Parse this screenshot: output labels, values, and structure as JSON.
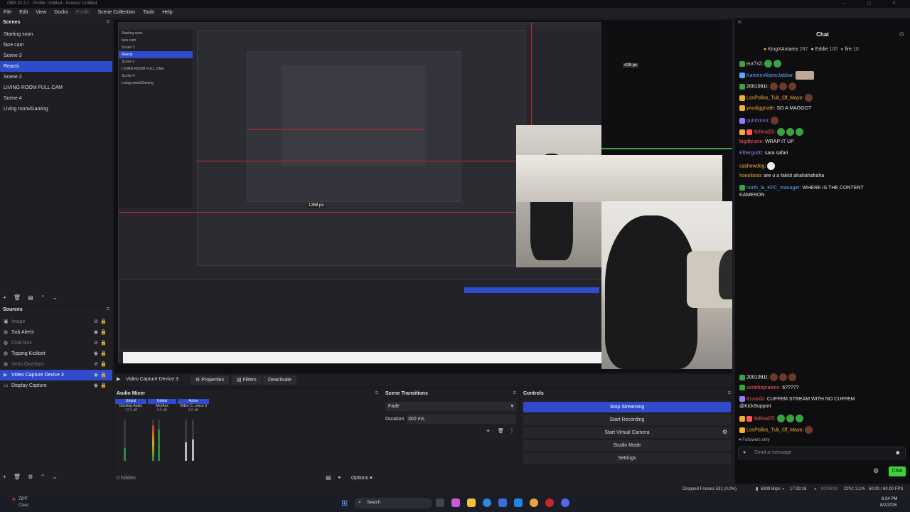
{
  "window": {
    "title": "OBS 32.2.1 - Profile: Untitled - Scenes: Untitled",
    "controls": "— ▢ ✕"
  },
  "menu": [
    "File",
    "Edit",
    "View",
    "Docks",
    "Profile",
    "Scene Collection",
    "Tools",
    "Help"
  ],
  "scenes": {
    "title": "Scenes",
    "items": [
      "Starting soon",
      "face cam",
      "Scene 3",
      "Reacts",
      "Scene 2",
      "LIVING ROOM FULL CAM",
      "Scene 4",
      "Living room/Gaming"
    ],
    "selected": "Reacts"
  },
  "sources": {
    "title": "Sources",
    "items": [
      {
        "label": "Image",
        "icon": "image-icon",
        "visible": false
      },
      {
        "label": "Sub Alerts",
        "icon": "browser-icon",
        "visible": true
      },
      {
        "label": "Chat Box",
        "icon": "browser-icon",
        "visible": false
      },
      {
        "label": "Tipping Kickbot",
        "icon": "browser-icon",
        "visible": true
      },
      {
        "label": "Verts Overlays",
        "icon": "browser-icon",
        "visible": false
      },
      {
        "label": "Video Capture Device 3",
        "icon": "camera-icon",
        "visible": true
      },
      {
        "label": "Display Capture",
        "icon": "monitor-icon",
        "visible": true
      }
    ],
    "selected": "Video Capture Device 3"
  },
  "preview": {
    "nested_px_label": "1268 px",
    "nested_px_label2": "429 px"
  },
  "source_toolbar": {
    "selected_source": "Video Capture Device 3",
    "properties": "Properties",
    "filters": "Filters",
    "deactivate": "Deactivate"
  },
  "audio_mixer": {
    "title": "Audio Mixer",
    "channels": [
      {
        "header": "Global",
        "name": "Desktop Audio",
        "db": "-12.5 dB"
      },
      {
        "header": "Global",
        "name": "Mic/Aux",
        "db": "0.0 dB"
      },
      {
        "header": "Active",
        "name": "Video C...evice 3",
        "db": "0.0 dB"
      }
    ],
    "hidden_count": "0 hidden",
    "options": "Options"
  },
  "transitions": {
    "title": "Scene Transitions",
    "selected": "Fade",
    "duration_label": "Duration",
    "duration_value": "300 ms"
  },
  "controls": {
    "title": "Controls",
    "buttons": [
      "Stop Streaming",
      "Start Recording",
      "Start Virtual Camera",
      "Studio Mode",
      "Settings"
    ]
  },
  "chat": {
    "title": "Chat",
    "top_gifters": [
      {
        "name": "KingXAntarez",
        "count": "247"
      },
      {
        "name": "Eddie",
        "count": "100"
      },
      {
        "name": "fire",
        "count": "10"
      }
    ],
    "messages_top": [
      {
        "user": "eur7x3:",
        "text": "",
        "color": "#d8d8d8"
      },
      {
        "user": "KareemAbjewJabbar:",
        "text": "",
        "color": "#5aa7ff"
      },
      {
        "user": "2001091t:",
        "text": "",
        "color": "#ffffff"
      },
      {
        "user": "LosPollos_Tub_Of_Mayo:",
        "text": "",
        "color": "#f1b12f"
      },
      {
        "user": "youdiggrude:",
        "text": "SO A MAGGOT",
        "color": "#f1b12f"
      },
      {
        "user": "quintxnnn:",
        "text": "",
        "color": "#9b7cff"
      },
      {
        "user": "itsReal25:",
        "text": "",
        "color": "#ff5a5a"
      },
      {
        "user": "bigdbrucie:",
        "text": "WRAP IT UP",
        "color": "#ff5a5a"
      },
      {
        "user": "Elbergud0:",
        "text": "sara safari",
        "color": "#9b7cff"
      },
      {
        "user": "cashewdog:",
        "text": "",
        "color": "#f1b12f"
      },
      {
        "user": "hoooliooo:",
        "text": "are u a fakkit ahahahahaha",
        "color": "#f1b12f"
      },
      {
        "user": "north_la_KFC_manager:",
        "text": "WHERE IS THE CONTENT",
        "color": "#5aa7ff"
      }
    ],
    "wrap_line": "KAMERON",
    "messages_bottom": [
      {
        "user": "2001091t:",
        "text": "",
        "color": "#ffffff"
      },
      {
        "user": "soratheprawnn:",
        "text": "6?????",
        "color": "#ff5a5a"
      },
      {
        "user": "81zurdz:",
        "text": "CUFFEM STREAM WITH NO CUFFEM",
        "color": "#ff5a5a"
      },
      {
        "user": "",
        "text": "@KickSupport",
        "color": "#e8e8e8"
      },
      {
        "user": "itsReal25:",
        "text": "",
        "color": "#ff5a5a"
      },
      {
        "user": "LosPollos_Tub_Of_Mayo:",
        "text": "",
        "color": "#f1b12f"
      }
    ],
    "followers_only": "Followers only",
    "input_placeholder": "Send a message",
    "send_button": "Chat"
  },
  "status": {
    "dropped_frames": "Dropped Frames 531 (0.0%)",
    "bitrate": "6309 kbps",
    "stream_time": "17:29:16",
    "rec_time": "00:00:00",
    "cpu": "CPU: 3.1%",
    "fps": "60.00 / 60.00 FPS"
  },
  "taskbar": {
    "weather_temp": "72°F",
    "weather_desc": "Clear",
    "search": "Search",
    "time": "8:34 PM",
    "date": "8/2/2026"
  }
}
